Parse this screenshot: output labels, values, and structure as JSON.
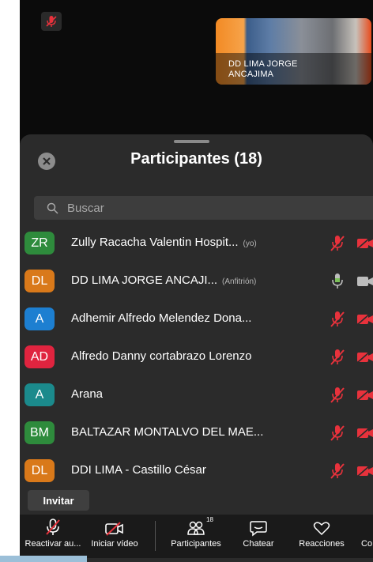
{
  "video": {
    "active_speaker_name": "DD LIMA JORGE ANCAJIMA"
  },
  "panel": {
    "title": "Participantes (18)",
    "search_placeholder": "Buscar",
    "invite_label": "Invitar",
    "participants": [
      {
        "initials": "ZR",
        "name": "Zully Racacha Valentin Hospit...",
        "tag": "(yo)",
        "avatar_color": "#2e8b3c",
        "mic": "muted",
        "video": "off"
      },
      {
        "initials": "DL",
        "name": "DD LIMA JORGE ANCAJI...",
        "tag": "(Anfitrión)",
        "avatar_color": "#d9791a",
        "mic": "on",
        "video": "on"
      },
      {
        "initials": "A",
        "name": "Adhemir Alfredo Melendez Dona...",
        "tag": "",
        "avatar_color": "#1d7fd1",
        "mic": "muted",
        "video": "off"
      },
      {
        "initials": "AD",
        "name": "Alfredo Danny cortabrazo Lorenzo",
        "tag": "",
        "avatar_color": "#e0243f",
        "mic": "muted",
        "video": "off"
      },
      {
        "initials": "A",
        "name": "Arana",
        "tag": "",
        "avatar_color": "#1b8a8c",
        "mic": "muted",
        "video": "off"
      },
      {
        "initials": "BM",
        "name": "BALTAZAR MONTALVO DEL MAE...",
        "tag": "",
        "avatar_color": "#2e8b3c",
        "mic": "muted",
        "video": "off"
      },
      {
        "initials": "DL",
        "name": "DDI LIMA - Castillo César",
        "tag": "",
        "avatar_color": "#d9791a",
        "mic": "muted",
        "video": "off"
      }
    ]
  },
  "toolbar": {
    "unmute_label": "Reactivar au...",
    "start_video_label": "Iniciar vídeo",
    "participants_label": "Participantes",
    "participants_count": "18",
    "chat_label": "Chatear",
    "reactions_label": "Reacciones",
    "more_label": "Co"
  },
  "colors": {
    "muted_red": "#e8323c",
    "panel_bg": "#2b2b2b",
    "mic_on_green": "#7cc05a"
  }
}
